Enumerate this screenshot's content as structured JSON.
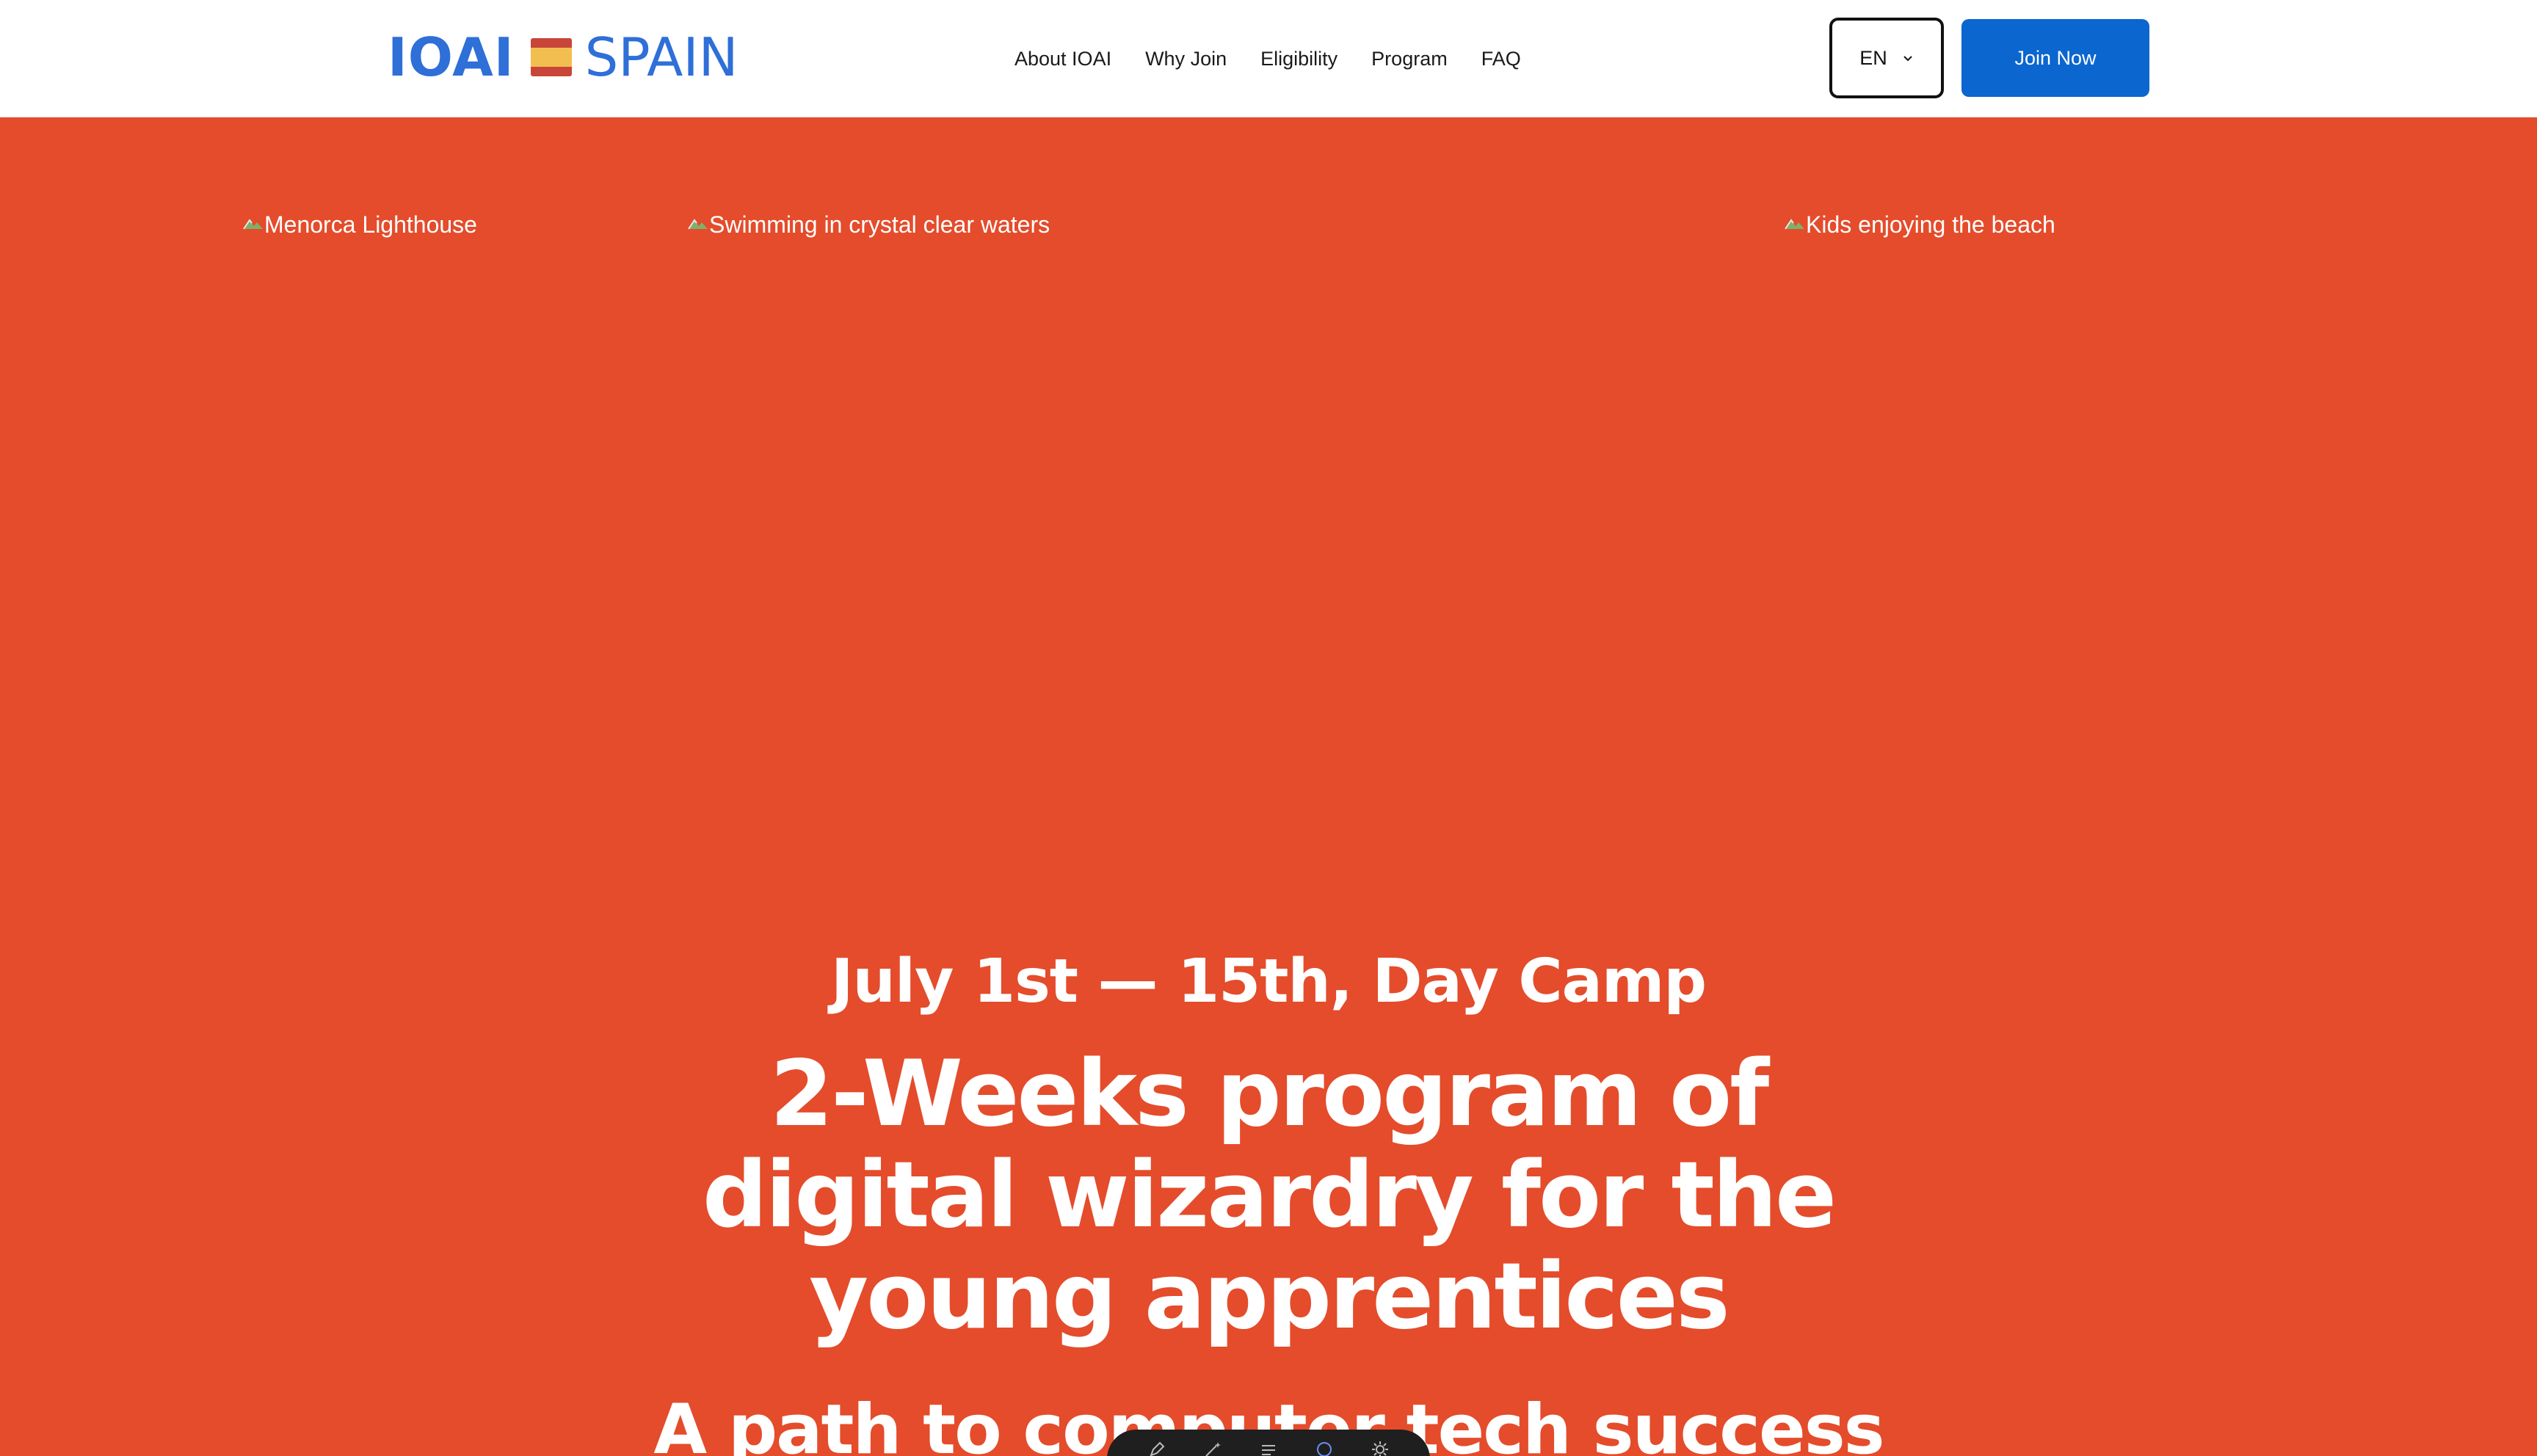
{
  "header": {
    "logo": {
      "text_left": "IOAI",
      "text_right": "SPAIN",
      "flag": "spain-flag-icon",
      "color": "#2E6FD8"
    },
    "nav": [
      {
        "label": "About IOAI"
      },
      {
        "label": "Why Join"
      },
      {
        "label": "Eligibility"
      },
      {
        "label": "Program"
      },
      {
        "label": "FAQ"
      }
    ],
    "language": {
      "selected": "EN",
      "icon": "chevron-down-icon"
    },
    "cta": {
      "label": "Join Now",
      "color": "#0B66CF"
    }
  },
  "gallery": {
    "images": [
      {
        "alt": "Menorca Lighthouse",
        "icon": "broken-image-icon"
      },
      {
        "alt": "Swimming in crystal clear waters",
        "icon": "broken-image-icon"
      },
      {
        "alt": "Kids enjoying the beach",
        "icon": "broken-image-icon"
      }
    ]
  },
  "hero": {
    "dates": "July 1st — 15th, Day Camp",
    "title": "2-Weeks program of digital wizardry for the young apprentices",
    "subtitle": "A path to computer tech success",
    "background": "#E44C2B"
  },
  "dock": {
    "icons": [
      "pen-icon",
      "wand-icon",
      "lines-icon",
      "circle-icon",
      "gear-icon"
    ]
  }
}
